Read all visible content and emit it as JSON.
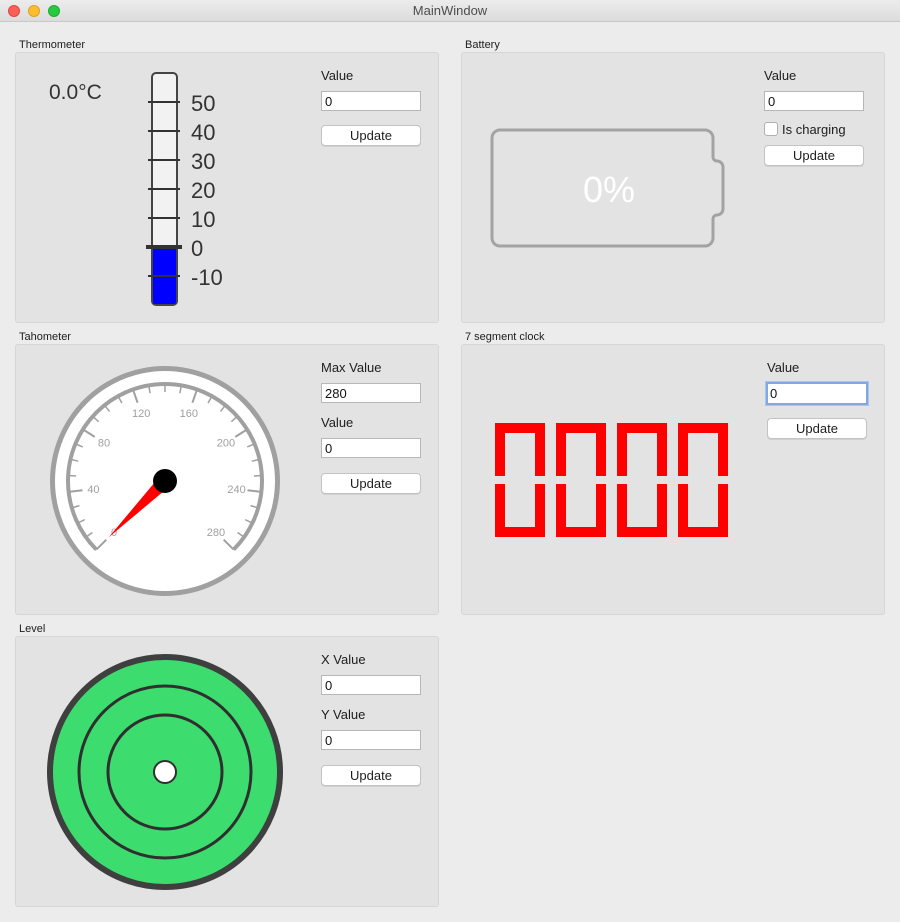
{
  "window": {
    "title": "MainWindow"
  },
  "thermometer": {
    "group_label": "Thermometer",
    "reading": "0.0°C",
    "scale": [
      "50",
      "40",
      "30",
      "20",
      "10",
      "0",
      "-10"
    ],
    "field_label": "Value",
    "value": "0",
    "button": "Update",
    "fill_color": "#0000ff"
  },
  "battery": {
    "group_label": "Battery",
    "percent_text": "0%",
    "field_label": "Value",
    "value": "0",
    "charging_label": "Is charging",
    "charging": false,
    "button": "Update"
  },
  "tachometer": {
    "group_label": "Tahometer",
    "max_label": "Max Value",
    "max_value": "280",
    "field_label": "Value",
    "value": "0",
    "button": "Update",
    "ticks": [
      "0",
      "40",
      "80",
      "120",
      "160",
      "200",
      "240",
      "280"
    ],
    "needle_color": "#ff0000"
  },
  "clock": {
    "group_label": "7 segment clock",
    "field_label": "Value",
    "value": "0",
    "button": "Update",
    "digits": "0000",
    "segment_color": "#ff0000"
  },
  "level": {
    "group_label": "Level",
    "x_label": "X Value",
    "x_value": "0",
    "y_label": "Y Value",
    "y_value": "0",
    "button": "Update",
    "fill_color": "#3ddc6e"
  }
}
